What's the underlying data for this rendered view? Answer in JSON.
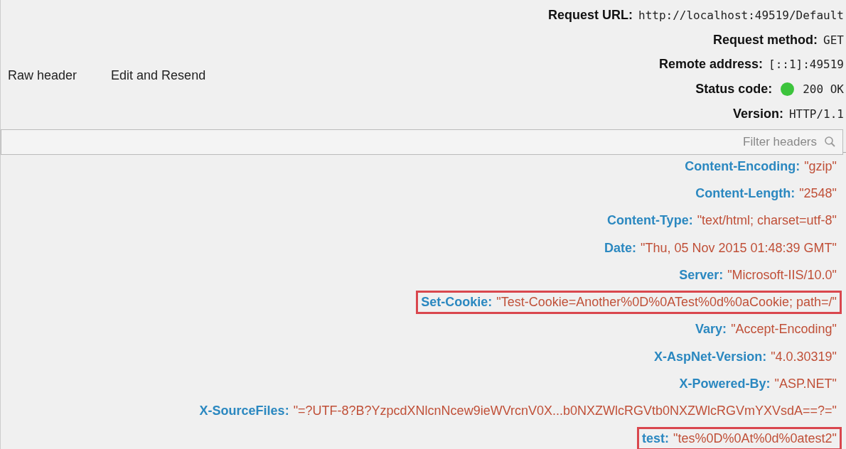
{
  "summary": [
    {
      "label": "Request URL:",
      "value": "http://localhost:49519/Default"
    },
    {
      "label": "Request method:",
      "value": "GET"
    },
    {
      "label": "Remote address:",
      "value": "[::1]:49519"
    },
    {
      "label": "Status code:",
      "value": "200 OK",
      "color": "#3cc43c"
    },
    {
      "label": "Version:",
      "value": "HTTP/1.1"
    }
  ],
  "actions": [
    "Raw header",
    "Edit and Resend"
  ],
  "filter": {
    "placeholder": "Filter headers"
  },
  "headers": [
    {
      "name": "Content-Encoding:",
      "value": "\"gzip\"",
      "highlighted": false
    },
    {
      "name": "Content-Length:",
      "value": "\"2548\"",
      "highlighted": false
    },
    {
      "name": "Content-Type:",
      "value": "\"text/html; charset=utf-8\"",
      "highlighted": false
    },
    {
      "name": "Date:",
      "value": "\"Thu, 05 Nov 2015 01:48:39 GMT\"",
      "highlighted": false
    },
    {
      "name": "Server:",
      "value": "\"Microsoft-IIS/10.0\"",
      "highlighted": false
    },
    {
      "name": "Set-Cookie:",
      "value": "\"Test-Cookie=Another%0D%0ATest%0d%0aCookie; path=/\"",
      "highlighted": true
    },
    {
      "name": "Vary:",
      "value": "\"Accept-Encoding\"",
      "highlighted": false
    },
    {
      "name": "X-AspNet-Version:",
      "value": "\"4.0.30319\"",
      "highlighted": false
    },
    {
      "name": "X-Powered-By:",
      "value": "\"ASP.NET\"",
      "highlighted": false
    },
    {
      "name": "X-SourceFiles:",
      "value": "\"=?UTF-8?B?YzpcdXNlcnNcew9ieWVrcnV0X...b0NXZWlcRGVtb0NXZWlcRGVmYXVsdA==?=\"",
      "highlighted": false
    },
    {
      "name": "test:",
      "value": "\"tes%0D%0At%0d%0atest2\"",
      "highlighted": true
    }
  ]
}
